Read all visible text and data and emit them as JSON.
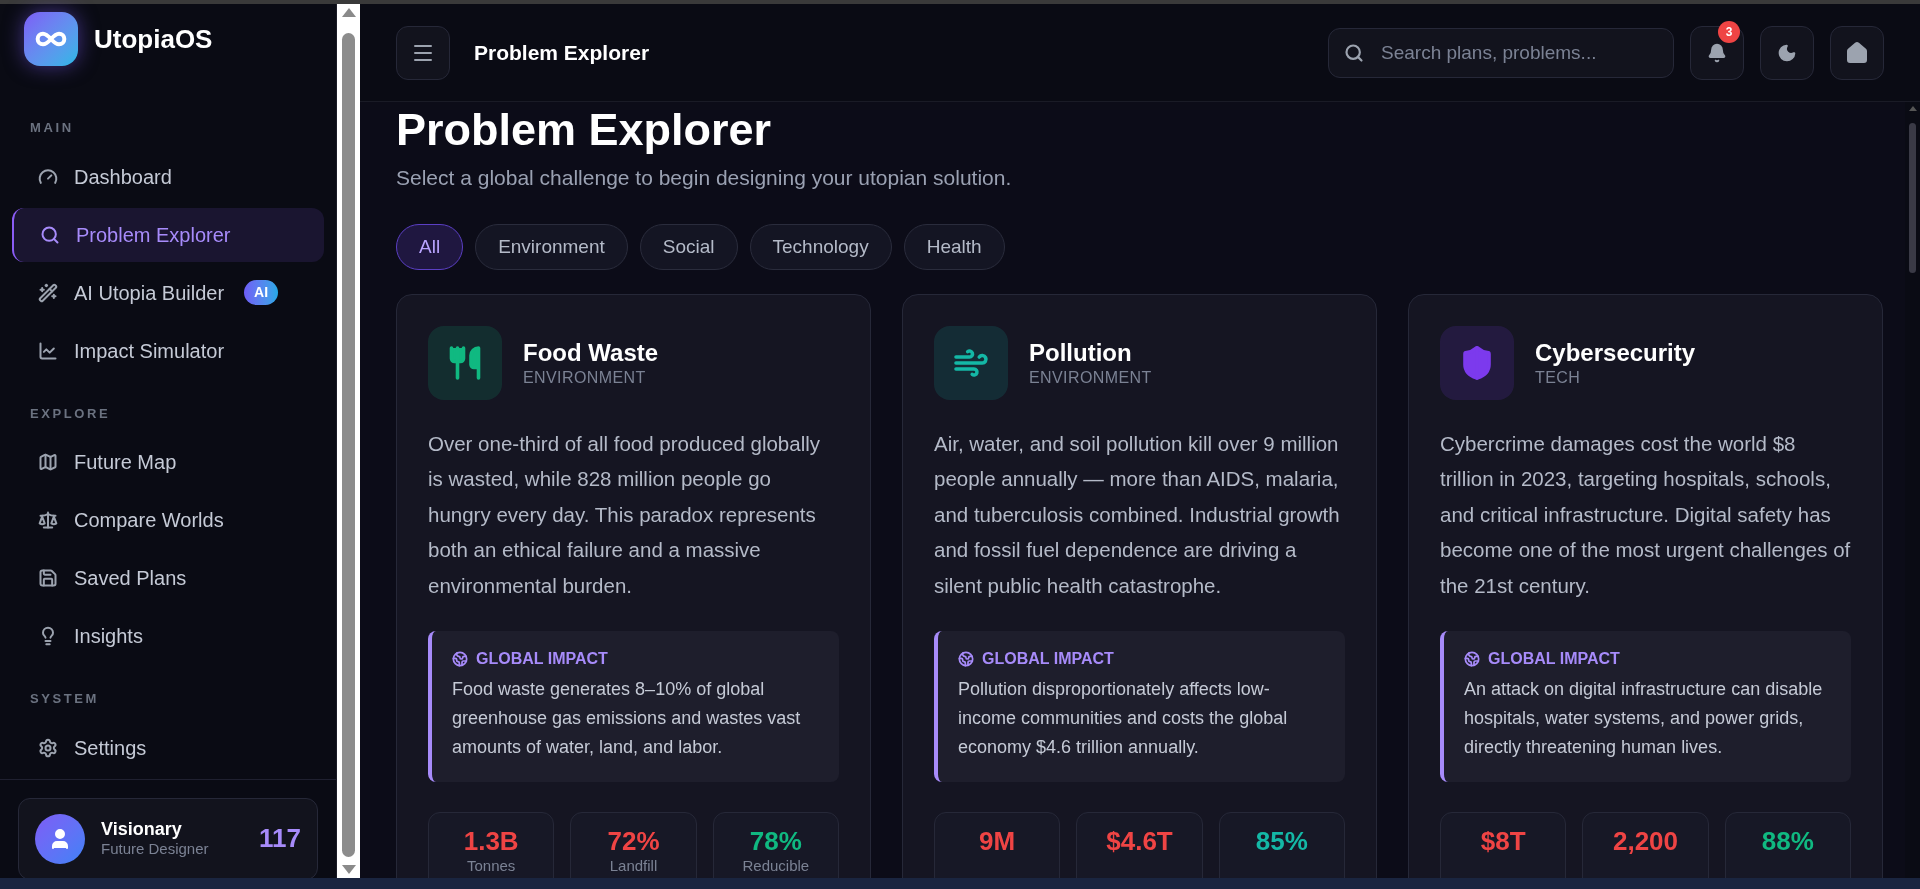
{
  "sidebar": {
    "brand": "UtopiaOS",
    "sections": [
      {
        "label": "MAIN",
        "items": [
          {
            "label": "Dashboard",
            "selected": false
          },
          {
            "label": "Problem Explorer",
            "selected": true
          },
          {
            "label": "AI Utopia Builder",
            "selected": false,
            "badge": "AI"
          },
          {
            "label": "Impact Simulator",
            "selected": false
          }
        ]
      },
      {
        "label": "EXPLORE",
        "items": [
          {
            "label": "Future Map",
            "selected": false
          },
          {
            "label": "Compare Worlds",
            "selected": false
          },
          {
            "label": "Saved Plans",
            "selected": false
          },
          {
            "label": "Insights",
            "selected": false
          }
        ]
      },
      {
        "label": "SYSTEM",
        "items": [
          {
            "label": "Settings",
            "selected": false
          }
        ]
      }
    ],
    "user": {
      "name": "Visionary",
      "role": "Future Designer",
      "score": "117"
    }
  },
  "header": {
    "title": "Problem Explorer",
    "search": {
      "placeholder": "Search plans, problems..."
    },
    "notifications": "3"
  },
  "page": {
    "title": "Problem Explorer",
    "subtitle": "Select a global challenge to begin designing your utopian solution.",
    "filters": [
      {
        "label": "All",
        "selected": true
      },
      {
        "label": "Environment",
        "selected": false
      },
      {
        "label": "Social",
        "selected": false
      },
      {
        "label": "Technology",
        "selected": false
      },
      {
        "label": "Health",
        "selected": false
      }
    ],
    "cards": [
      {
        "title": "Food Waste",
        "category": "ENVIRONMENT",
        "color": "#10b981",
        "description": "Over one-third of all food produced globally is wasted, while 828 million people go hungry every day. This paradox represents both an ethical failure and a massive environmental burden.",
        "impact_label": "GLOBAL IMPACT",
        "impact": "Food waste generates 8–10% of global greenhouse gas emissions and wastes vast amounts of water, land, and labor.",
        "stats": [
          {
            "value": "1.3B",
            "label": "Tonnes",
            "color": "#ef4444"
          },
          {
            "value": "72%",
            "label": "Landfill",
            "color": "#ef4444"
          },
          {
            "value": "78%",
            "label": "Reducible",
            "color": "#10b981"
          }
        ]
      },
      {
        "title": "Pollution",
        "category": "ENVIRONMENT",
        "color": "#14b8a6",
        "description": "Air, water, and soil pollution kill over 9 million people annually — more than AIDS, malaria, and tuberculosis combined. Industrial growth and fossil fuel dependence are driving a silent public health catastrophe.",
        "impact_label": "GLOBAL IMPACT",
        "impact": "Pollution disproportionately affects low-income communities and costs the global economy $4.6 trillion annually.",
        "stats": [
          {
            "value": "9M",
            "color": "#ef4444"
          },
          {
            "value": "$4.6T",
            "color": "#ef4444"
          },
          {
            "value": "85%",
            "color": "#14b8a6"
          }
        ]
      },
      {
        "title": "Cybersecurity",
        "category": "TECH",
        "color": "#7c3aed",
        "description": "Cybercrime damages cost the world $8 trillion in 2023, targeting hospitals, schools, and critical infrastructure. Digital safety has become one of the most urgent challenges of the 21st century.",
        "impact_label": "GLOBAL IMPACT",
        "impact": "An attack on digital infrastructure can disable hospitals, water systems, and power grids, directly threatening human lives.",
        "stats": [
          {
            "value": "$8T",
            "color": "#ef4444"
          },
          {
            "value": "2,200",
            "color": "#ef4444"
          },
          {
            "value": "88%",
            "color": "#10b981"
          }
        ]
      }
    ]
  }
}
